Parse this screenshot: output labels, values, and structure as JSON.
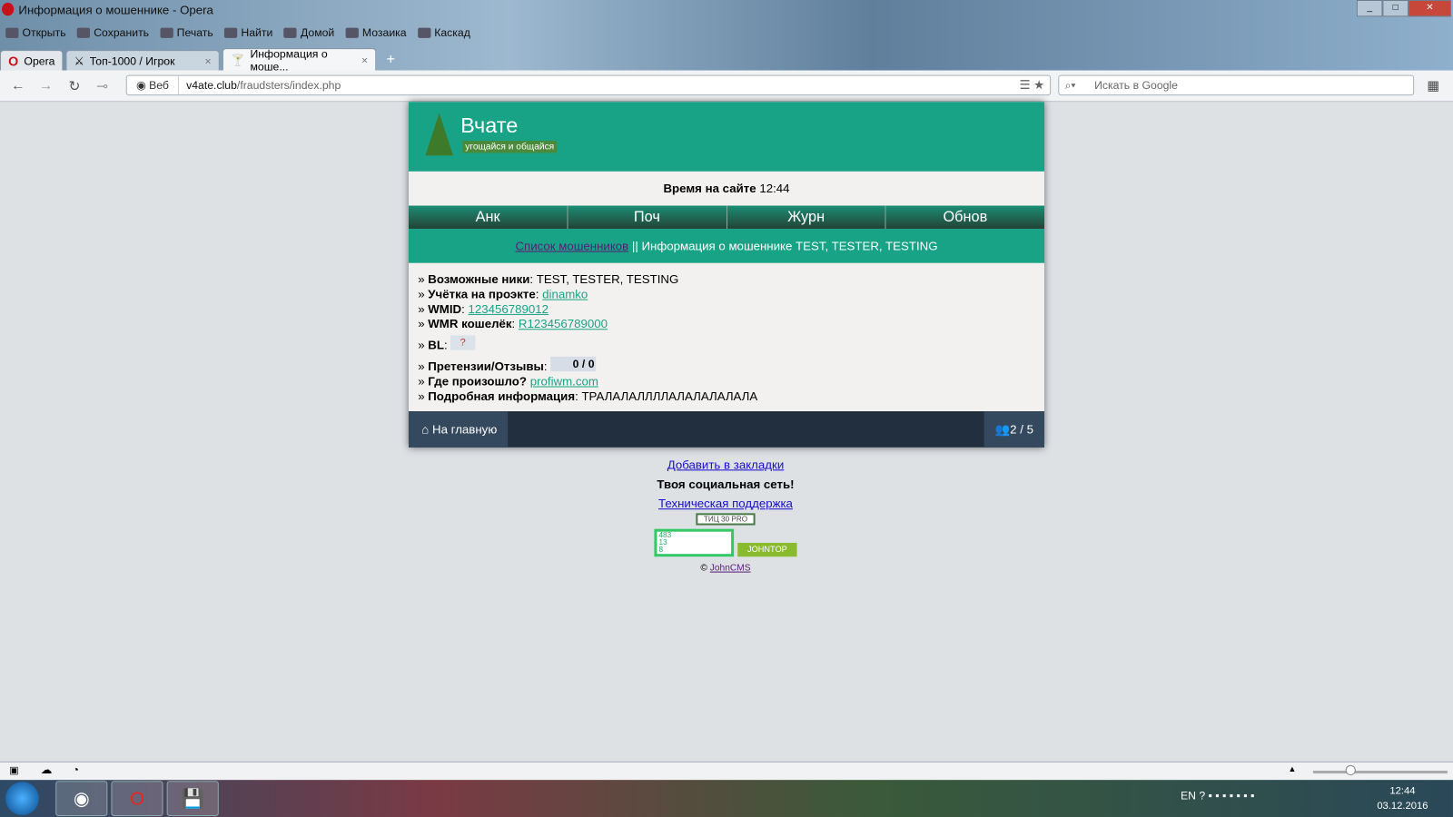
{
  "window": {
    "title": "Информация о мошеннике - Opera"
  },
  "menu": [
    "Открыть",
    "Сохранить",
    "Печать",
    "Найти",
    "Домой",
    "Мозаика",
    "Каскад"
  ],
  "tabs": {
    "opera": "Opera",
    "tab1": "Топ-1000 / Игрок",
    "tab2": "Информация о моше...",
    "close": "×",
    "new": "+"
  },
  "address": {
    "web": "Веб",
    "domain": "v4ate.club",
    "path": "/fraudsters/index.php",
    "search_placeholder": "Искать в Google"
  },
  "site": {
    "logo": "Вчате",
    "slogan": "угощайся и общайся",
    "time_label": "Время на сайте",
    "time": "12:44",
    "nav": [
      "Анк",
      "Поч",
      "Журн",
      "Обнов"
    ],
    "crumb_link": "Список мошенников",
    "crumb_text": " || Информация о мошеннике TEST, TESTER, TESTING",
    "info": {
      "nicks_label": "Возможные ники",
      "nicks": "TEST, TESTER, TESTING",
      "account_label": "Учётка на проэкте",
      "account": "dinamko",
      "wmid_label": "WMID",
      "wmid": "123456789012",
      "wmr_label": "WMR кошелёк",
      "wmr": "R123456789000",
      "bl_label": "BL",
      "bl": "?",
      "claims_label": "Претензии/Отзывы",
      "claims": "0 / 0",
      "where_label": "Где произошло?",
      "where": "profiwm.com",
      "details_label": "Подробная информация",
      "details": "ТРАЛАЛАЛЛЛЛАЛАЛАЛАЛАЛА"
    },
    "home": "На главную",
    "online": "2 / 5"
  },
  "below": {
    "bookmark": "Добавить в закладки",
    "social": "Твоя социальная сеть!",
    "support": "Техническая поддержка",
    "tic": "ТИЦ 30   PRO",
    "counter": [
      "483",
      "13",
      "8"
    ],
    "johntop": "JOHNTOP",
    "copyright_prefix": "©",
    "copyright": "JohnCMS"
  },
  "tray": {
    "lang": "EN",
    "time": "12:44",
    "date": "03.12.2016"
  }
}
